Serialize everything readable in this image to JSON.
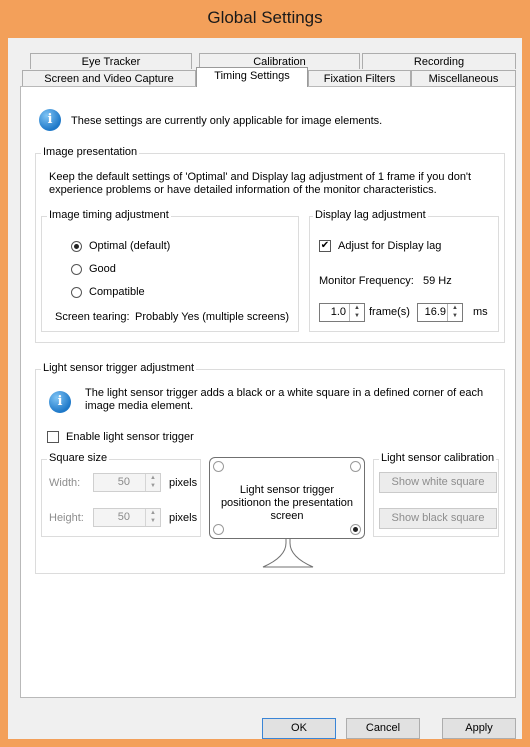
{
  "window": {
    "title": "Global Settings"
  },
  "tabs": {
    "row1": [
      "Eye Tracker",
      "Calibration",
      "Recording"
    ],
    "row2": [
      "Screen and Video Capture",
      "Timing Settings",
      "Fixation Filters",
      "Miscellaneous"
    ],
    "active": "Timing Settings"
  },
  "info_top": "These settings are currently only applicable for image elements.",
  "image_presentation": {
    "label": "Image presentation",
    "description": "Keep the default settings of 'Optimal' and Display lag adjustment of 1 frame if you don't experience problems or have detailed information of the monitor characteristics.",
    "timing": {
      "label": "Image timing adjustment",
      "options": [
        "Optimal (default)",
        "Good",
        "Compatible"
      ],
      "selected": "Optimal (default)",
      "screen_tearing_label": "Screen tearing:",
      "screen_tearing_value": "Probably Yes (multiple screens)"
    },
    "display_lag": {
      "label": "Display lag adjustment",
      "adjust_label": "Adjust for Display lag",
      "adjust_checked": true,
      "monitor_freq_label": "Monitor Frequency:",
      "monitor_freq_value": "59 Hz",
      "frames_value": "1.0",
      "frames_unit": "frame(s)",
      "ms_value": "16.9",
      "ms_unit": "ms"
    }
  },
  "light_sensor": {
    "label": "Light sensor trigger adjustment",
    "info": "The light sensor trigger adds a black or a white square in a defined corner of each image media element.",
    "enable_label": "Enable light sensor trigger",
    "enable_checked": false,
    "square_size": {
      "label": "Square size",
      "width_label": "Width:",
      "width_value": "50",
      "height_label": "Height:",
      "height_value": "50",
      "unit": "pixels"
    },
    "position_text": "Light sensor trigger positionon the presentation screen",
    "selected_corner": "bottom-right",
    "calibration": {
      "label": "Light sensor calibration",
      "white_button": "Show white square",
      "black_button": "Show black square"
    }
  },
  "footer": {
    "ok": "OK",
    "cancel": "Cancel",
    "apply": "Apply"
  }
}
